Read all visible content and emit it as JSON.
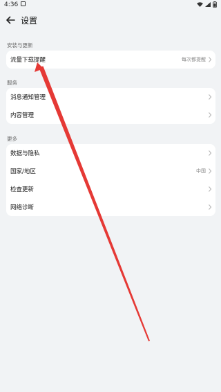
{
  "status_bar": {
    "time": "4:36"
  },
  "header": {
    "title": "设置"
  },
  "sections": [
    {
      "label": "安装与更新",
      "rows": [
        {
          "label": "流量下载提醒",
          "value": "每次都提醒"
        }
      ]
    },
    {
      "label": "服务",
      "rows": [
        {
          "label": "消息通知管理",
          "value": ""
        },
        {
          "label": "内容管理",
          "value": ""
        }
      ]
    },
    {
      "label": "更多",
      "rows": [
        {
          "label": "数据与隐私",
          "value": ""
        },
        {
          "label": "国家/地区",
          "value": "中国"
        },
        {
          "label": "检查更新",
          "value": ""
        },
        {
          "label": "网络诊断",
          "value": ""
        }
      ]
    }
  ],
  "colors": {
    "background": "#f1f3f5",
    "card": "#ffffff",
    "annotation_arrow": "#e53935"
  },
  "icons": {
    "back": "arrow-left-icon",
    "chevron": "chevron-right-icon",
    "wifi": "wifi-icon",
    "signal": "signal-icon",
    "battery": "battery-icon"
  }
}
